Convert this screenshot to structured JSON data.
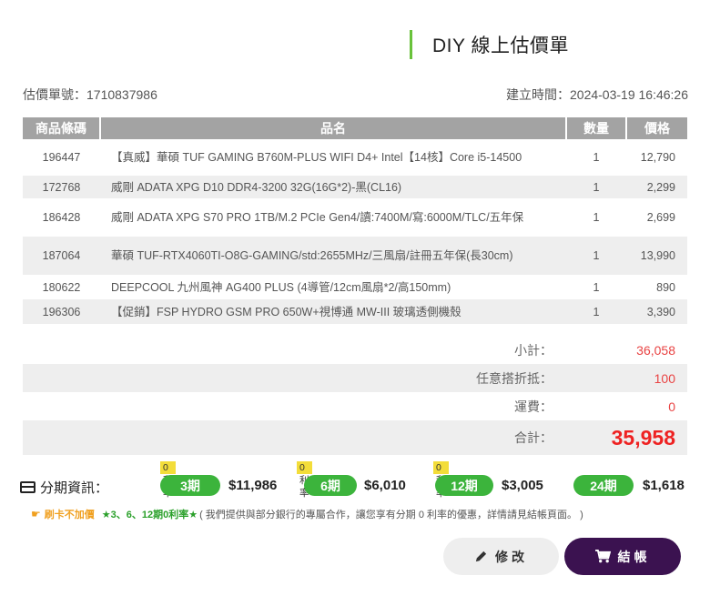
{
  "header": {
    "title": "DIY 線上估價單",
    "quote_no": "估價單號：1710837986",
    "created": "建立時間：2024-03-19 16:46:26"
  },
  "table": {
    "headers": {
      "code": "商品條碼",
      "name": "品名",
      "qty": "數量",
      "price": "價格"
    },
    "rows": [
      {
        "code": "196447",
        "name": "【真威】華碩 TUF GAMING B760M-PLUS WIFI D4+ Intel【14核】Core i5-14500",
        "qty": "1",
        "price": "12,790"
      },
      {
        "code": "172768",
        "name": "威剛 ADATA XPG D10 DDR4-3200 32G(16G*2)-黑(CL16)",
        "qty": "1",
        "price": "2,299"
      },
      {
        "code": "186428",
        "name": "威剛 ADATA XPG S70 PRO 1TB/M.2 PCIe Gen4/讀:7400M/寫:6000M/TLC/五年保",
        "qty": "1",
        "price": "2,699"
      },
      {
        "code": "187064",
        "name": "華碩 TUF-RTX4060TI-O8G-GAMING/std:2655MHz/三風扇/註冊五年保(長30cm)",
        "qty": "1",
        "price": "13,990"
      },
      {
        "code": "180622",
        "name": "DEEPCOOL 九州風神 AG400 PLUS (4導管/12cm風扇*2/高150mm)",
        "qty": "1",
        "price": "890"
      },
      {
        "code": "196306",
        "name": "【促銷】FSP HYDRO GSM PRO 650W+視博通 MW-III 玻璃透側機殼",
        "qty": "1",
        "price": "3,390"
      }
    ]
  },
  "summary": {
    "subtotal_label": "小計：",
    "subtotal": "36,058",
    "discount_label": "任意搭折抵：",
    "discount": "100",
    "shipping_label": "運費：",
    "shipping": "0",
    "total_label": "合計：",
    "total": "35,958"
  },
  "installment": {
    "label": "分期資訊：",
    "plans": [
      {
        "tag": "0利率",
        "term": "3期",
        "amount": "$11,986"
      },
      {
        "tag": "0利率",
        "term": "6期",
        "amount": "$6,010"
      },
      {
        "tag": "0利率",
        "term": "12期",
        "amount": "$3,005"
      },
      {
        "tag": "",
        "term": "24期",
        "amount": "$1,618"
      }
    ],
    "note_a": "刷卡不加價",
    "note_b": "★3、6、12期0利率★",
    "note_c": "( 我們提供與部分銀行的專屬合作，讓您享有分期 0 利率的優惠，詳情請見結帳頁面。 )"
  },
  "buttons": {
    "edit": "修改",
    "checkout": "結帳"
  },
  "colors": {
    "accent_green": "#3cb43c",
    "title_bar": "#69c23b",
    "checkout_bg": "#3b1250",
    "total_red": "#ee2222",
    "tag_yellow": "#f3dd3a"
  },
  "icons": {
    "installment": "credit-card-icon",
    "note": "pointing-hand-icon",
    "edit": "pencil-icon",
    "checkout": "cart-icon"
  }
}
